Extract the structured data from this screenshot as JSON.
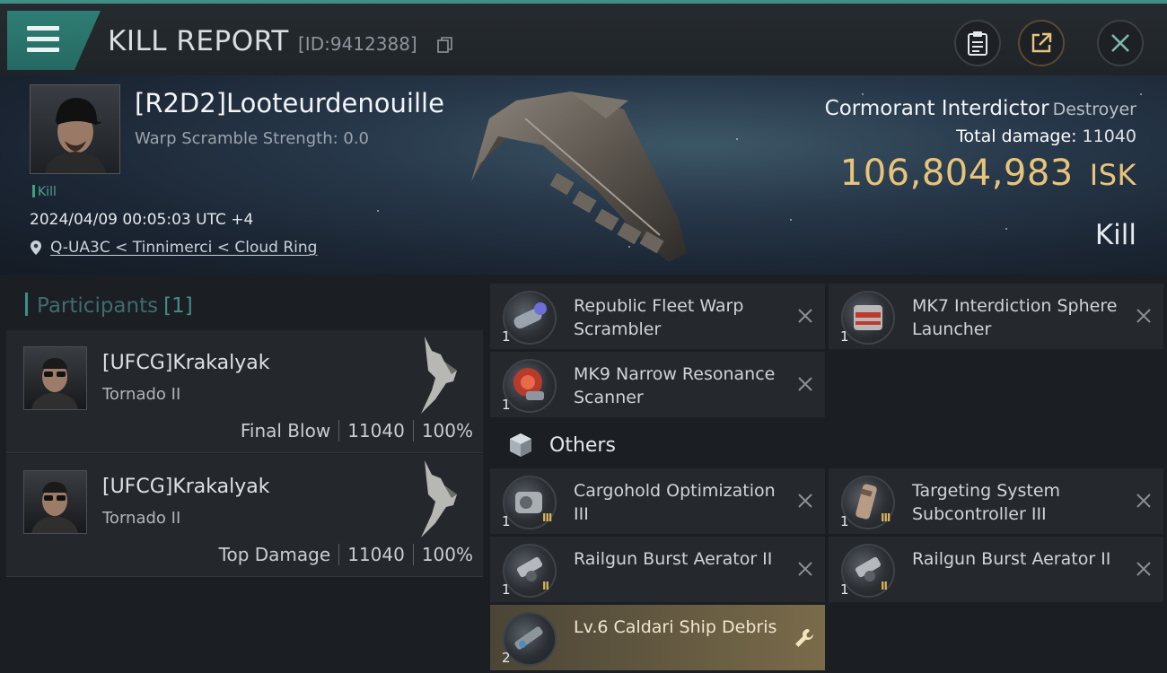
{
  "header": {
    "title": "KILL REPORT",
    "report_id": "[ID:9412388]",
    "accent_color": "#3f8f86"
  },
  "victim": {
    "name": "[R2D2]Looteurdenouille",
    "warp_scramble": "Warp Scramble Strength: 0.0",
    "tag": "Kill",
    "datetime": "2024/04/09 00:05:03 UTC +4",
    "location": "Q-UA3C < Tinnimerci < Cloud Ring"
  },
  "ship": {
    "name": "Cormorant Interdictor",
    "class": "Destroyer",
    "total_damage_label": "Total damage:",
    "total_damage": "11040",
    "value": "106,804,983",
    "currency": "ISK",
    "result": "Kill"
  },
  "participants": {
    "title": "Participants",
    "count": "[1]",
    "rows": [
      {
        "name": "[UFCG]Krakalyak",
        "ship": "Tornado II",
        "role": "Final Blow",
        "damage": "11040",
        "percent": "100%"
      },
      {
        "name": "[UFCG]Krakalyak",
        "ship": "Tornado II",
        "role": "Top Damage",
        "damage": "11040",
        "percent": "100%"
      }
    ]
  },
  "modules": [
    {
      "name": "Republic Fleet Warp Scrambler",
      "qty": "1",
      "tier": "",
      "icon": "warp-scrambler-icon"
    },
    {
      "name": "MK7 Interdiction Sphere Launcher",
      "qty": "1",
      "tier": "",
      "icon": "sphere-launcher-icon"
    },
    {
      "name": "MK9 Narrow Resonance Scanner",
      "qty": "1",
      "tier": "",
      "icon": "resonance-scanner-icon"
    }
  ],
  "others": {
    "label": "Others",
    "items": [
      {
        "name": "Cargohold Optimization III",
        "qty": "1",
        "tier": "III",
        "icon": "cargohold-rig-icon"
      },
      {
        "name": "Targeting System Subcontroller III",
        "qty": "1",
        "tier": "III",
        "icon": "targeting-rig-icon"
      },
      {
        "name": "Railgun Burst Aerator II",
        "qty": "1",
        "tier": "II",
        "icon": "railgun-rig-icon"
      },
      {
        "name": "Railgun Burst Aerator II",
        "qty": "1",
        "tier": "II",
        "icon": "railgun-rig-icon"
      },
      {
        "name": "Lv.6 Caldari Ship Debris",
        "qty": "2",
        "tier": "",
        "icon": "ship-debris-icon"
      }
    ]
  }
}
